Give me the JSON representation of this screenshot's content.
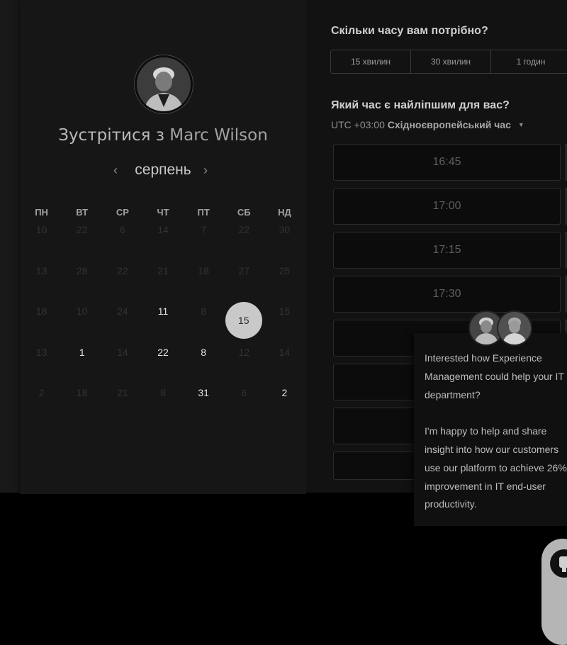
{
  "meeting": {
    "title_prefix": "Зустрітися з",
    "host_name": "Marc Wilson"
  },
  "calendar": {
    "month": "серпень",
    "weekdays": [
      "ПН",
      "ВТ",
      "СР",
      "ЧТ",
      "ПТ",
      "СБ",
      "НД"
    ],
    "weeks": [
      [
        "10",
        "22",
        "6",
        "14",
        "7",
        "22",
        "30"
      ],
      [
        "13",
        "28",
        "22",
        "21",
        "18",
        "27",
        "25"
      ],
      [
        "18",
        "10",
        "24",
        "11",
        "8",
        "15",
        "15"
      ],
      [
        "13",
        "1",
        "14",
        "22",
        "8",
        "12",
        "14"
      ],
      [
        "2",
        "18",
        "21",
        "8",
        "31",
        "6",
        "2"
      ]
    ],
    "available": [
      [
        2,
        3
      ],
      [
        2,
        5
      ],
      [
        3,
        1
      ],
      [
        3,
        3
      ],
      [
        3,
        4
      ],
      [
        4,
        4
      ],
      [
        4,
        6
      ]
    ],
    "selected": [
      2,
      5
    ]
  },
  "duration": {
    "question": "Скільки часу вам потрібно?",
    "options": [
      "15 хвилин",
      "30 хвилин",
      "1 годин"
    ]
  },
  "time": {
    "question": "Який час є найліпшим для вас?",
    "tz_offset": "UTC +03:00",
    "tz_name": "Східноєвропейський час",
    "slots": [
      "16:45",
      "17:00",
      "17:15",
      "17:30",
      "",
      "",
      ""
    ]
  },
  "chat": {
    "message_1": "Interested how Experience Management could help your IT department?",
    "message_2": "I'm happy to help and share insight into how our customers use our platform to achieve 26% improvement in IT end-user productivity."
  }
}
